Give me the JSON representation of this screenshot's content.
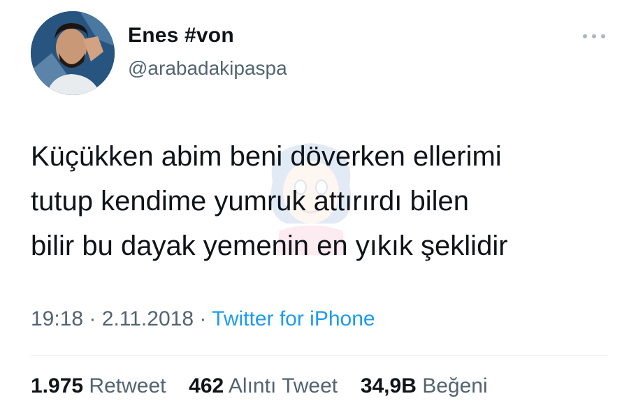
{
  "user": {
    "display_name": "Enes #von",
    "username": "@arabadakipaspa",
    "avatar_icon": "user-avatar"
  },
  "menu": {
    "more_icon": "more-dots-icon"
  },
  "tweet": {
    "lines": [
      "Küçükken abim beni döverken ellerimi",
      "tutup kendime yumruk attırırdı bilen",
      "bilir bu dayak yemenin en yıkık şeklidir"
    ]
  },
  "meta": {
    "time": "19:18",
    "separator": "·",
    "date": "2.11.2018",
    "source": "Twitter for iPhone"
  },
  "stats": {
    "retweets": {
      "count": "1.975",
      "label": "Retweet"
    },
    "quotes": {
      "count": "462",
      "label": "Alıntı Tweet"
    },
    "likes": {
      "count": "34,9B",
      "label": "Beğeni"
    }
  },
  "colors": {
    "text": "#0f1419",
    "secondary": "#536471",
    "link": "#1d9bf0",
    "divider": "#e1e8ed"
  }
}
